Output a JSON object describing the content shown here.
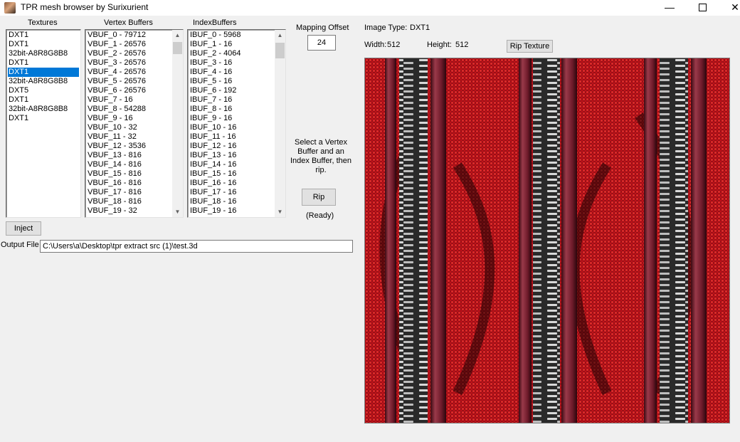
{
  "window": {
    "title": "TPR mesh browser by Surixurient",
    "controls": [
      "minimize-icon",
      "maximize-icon",
      "close-icon"
    ]
  },
  "textures": {
    "label": "Textures",
    "items": [
      "DXT1",
      "DXT1",
      "32bit-A8R8G8B8",
      "DXT1",
      "DXT1",
      "32bit-A8R8G8B8",
      "DXT5",
      "DXT1",
      "32bit-A8R8G8B8",
      "DXT1"
    ],
    "selected_index": 4
  },
  "vertex_buffers": {
    "label": "Vertex Buffers",
    "items": [
      "VBUF_0 - 79712",
      "VBUF_1 - 26576",
      "VBUF_2 - 26576",
      "VBUF_3 - 26576",
      "VBUF_4 - 26576",
      "VBUF_5 - 26576",
      "VBUF_6 - 26576",
      "VBUF_7 - 16",
      "VBUF_8 - 54288",
      "VBUF_9 - 16",
      "VBUF_10 - 32",
      "VBUF_11 - 32",
      "VBUF_12 - 3536",
      "VBUF_13 - 816",
      "VBUF_14 - 816",
      "VBUF_15 - 816",
      "VBUF_16 - 816",
      "VBUF_17 - 816",
      "VBUF_18 - 816",
      "VBUF_19 - 32"
    ]
  },
  "index_buffers": {
    "label": "IndexBuffers",
    "items": [
      "IBUF_0 - 5968",
      "IBUF_1 - 16",
      "IBUF_2 - 4064",
      "IBUF_3 - 16",
      "IBUF_4 - 16",
      "IBUF_5 - 16",
      "IBUF_6 - 192",
      "IBUF_7 - 16",
      "IBUF_8 - 16",
      "IBUF_9 - 16",
      "IBUF_10 - 16",
      "IBUF_11 - 16",
      "IBUF_12 - 16",
      "IBUF_13 - 16",
      "IBUF_14 - 16",
      "IBUF_15 - 16",
      "IBUF_16 - 16",
      "IBUF_17 - 16",
      "IBUF_18 - 16",
      "IBUF_19 - 16"
    ]
  },
  "mapping_offset": {
    "label": "Mapping Offset",
    "value": "24"
  },
  "instructions": {
    "line1": "Select a Vertex",
    "line2": "Buffer and an",
    "line3": "Index Buffer, then",
    "line4": "rip."
  },
  "rip": {
    "button_label": "Rip",
    "status": "(Ready)"
  },
  "inject": {
    "button_label": "Inject"
  },
  "output_file": {
    "label": "Output File",
    "value": "C:\\Users\\a\\Desktop\\tpr extract src (1)\\test.3d"
  },
  "image_info": {
    "type_label": "Image Type:",
    "type_value": "DXT1",
    "width_label": "Width:",
    "width_value": "512",
    "height_label": "Height:",
    "height_value": "512",
    "rip_texture_label": "Rip Texture"
  },
  "texture_preview": {
    "description_colors": {
      "base": "#c4101a",
      "strap": "#6e1a2a",
      "teeth": "#d8d8d8"
    }
  }
}
